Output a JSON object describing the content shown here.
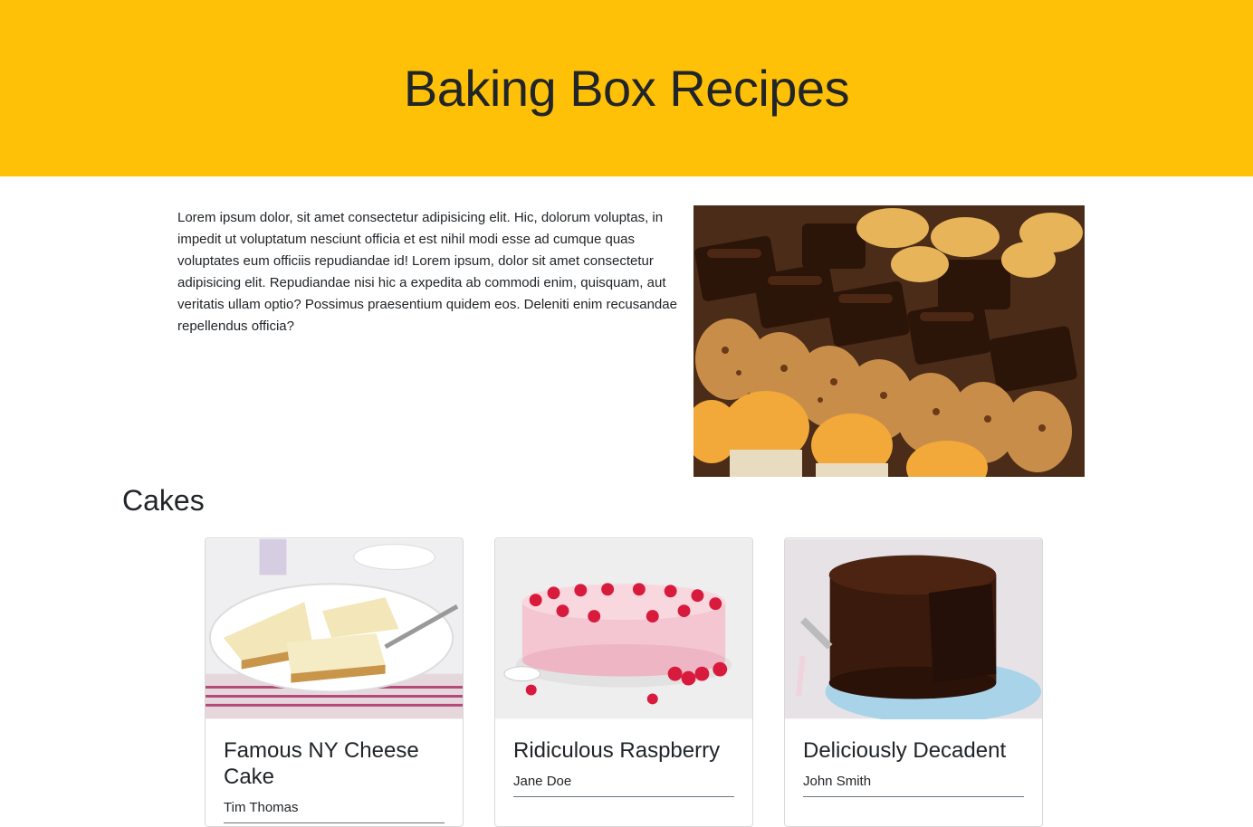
{
  "header": {
    "title": "Baking Box Recipes"
  },
  "intro": {
    "text": "Lorem ipsum dolor, sit amet consectetur adipisicing elit. Hic, dolorum voluptas, in impedit ut voluptatum nesciunt officia et est nihil modi esse ad cumque quas voluptates eum officiis repudiandae id! Lorem ipsum, dolor sit amet consectetur adipisicing elit. Repudiandae nisi hic a expedita ab commodi enim, quisquam, aut veritatis ullam optio? Possimus praesentium quidem eos. Deleniti enim recusandae repellendus officia?"
  },
  "section": {
    "title": "Cakes"
  },
  "cards": [
    {
      "title": "Famous NY Cheese Cake",
      "author": "Tim Thomas"
    },
    {
      "title": "Ridiculous Raspberry",
      "author": "Jane Doe"
    },
    {
      "title": "Deliciously Decadent",
      "author": "John Smith"
    }
  ],
  "colors": {
    "hero_bg": "#ffc107",
    "text": "#212529"
  }
}
